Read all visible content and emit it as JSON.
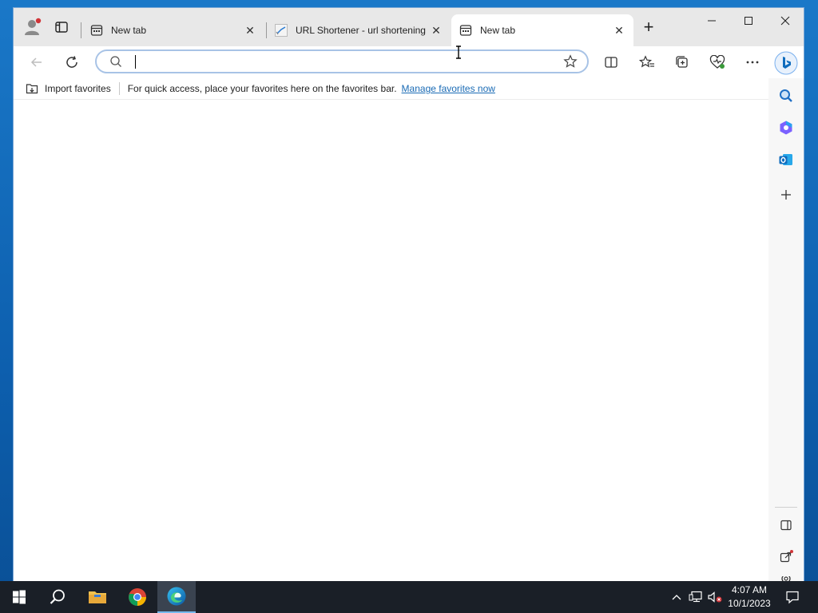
{
  "browser": {
    "tabs": [
      {
        "label": "New tab",
        "favicon": "newtab-icon",
        "active": false
      },
      {
        "label": "URL Shortener - url shortening",
        "favicon": "site-favicon",
        "active": false
      },
      {
        "label": "New tab",
        "favicon": "newtab-icon",
        "active": true
      }
    ],
    "new_tab_symbol": "+",
    "close_symbol": "✕",
    "address": {
      "value": "",
      "placeholder": ""
    },
    "favorites_bar": {
      "import_label": "Import favorites",
      "hint_text": "For quick access, place your favorites here on the favorites bar.",
      "manage_link": "Manage favorites now"
    }
  },
  "taskbar": {
    "time": "4:07 AM",
    "date": "10/1/2023"
  },
  "colors": {
    "titlebar": "#e8e8e8",
    "accent": "#0f6cbd",
    "link": "#1a6bb5",
    "taskbar": "#1a1f27"
  }
}
